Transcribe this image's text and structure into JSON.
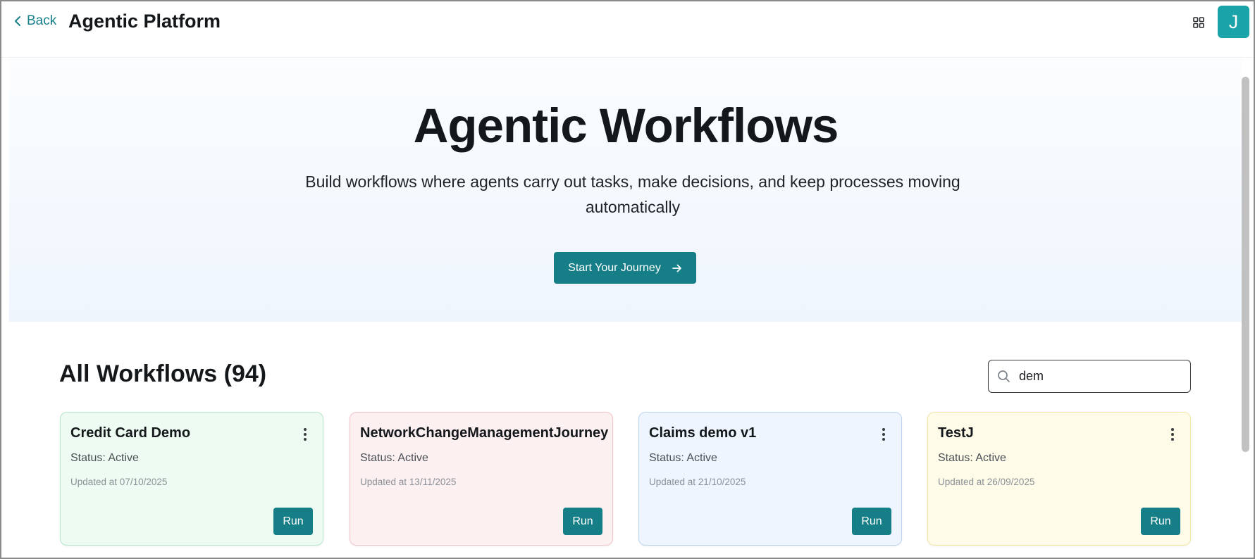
{
  "header": {
    "back_label": "Back",
    "app_title": "Agentic Platform",
    "avatar_initial": "J"
  },
  "hero": {
    "title": "Agentic Workflows",
    "subtitle": "Build workflows where agents carry out tasks, make decisions, and keep processes moving automatically",
    "cta_label": "Start Your Journey"
  },
  "workflows": {
    "section_title": "All Workflows (94)",
    "search_value": "dem",
    "cards": [
      {
        "title": "Credit Card Demo",
        "status": "Status: Active",
        "updated": "Updated at 07/10/2025",
        "run_label": "Run",
        "bg": "#edfbf2",
        "border": "#b8e8c8"
      },
      {
        "title": "NetworkChangeManagementJourney",
        "status": "Status: Active",
        "updated": "Updated at 13/11/2025",
        "run_label": "Run",
        "bg": "#fdf0f1",
        "border": "#f2c3c7"
      },
      {
        "title": "Claims demo v1",
        "status": "Status: Active",
        "updated": "Updated at 21/10/2025",
        "run_label": "Run",
        "bg": "#eef5fe",
        "border": "#bcd4ef"
      },
      {
        "title": "TestJ",
        "status": "Status: Active",
        "updated": "Updated at 26/09/2025",
        "run_label": "Run",
        "bg": "#fefbe8",
        "border": "#f1e6a8"
      }
    ]
  },
  "colors": {
    "accent": "#167e87",
    "avatar": "#1aa3a8"
  }
}
